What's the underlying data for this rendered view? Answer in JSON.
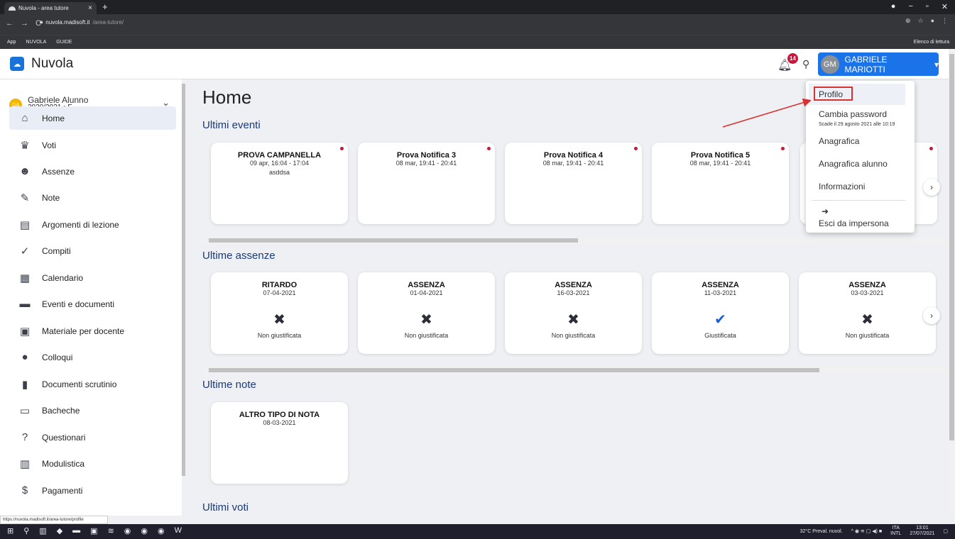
{
  "browser": {
    "tab_title": "Nuvola - area tutore",
    "tab_close": "×",
    "new_tab": "+",
    "url_host": "nuvola.madisoft.it",
    "url_path": "/area-tutore/",
    "nav_back": "←",
    "nav_forward": "→",
    "nav_reload": "C",
    "bookmarks": [
      "App",
      "NUVOLA",
      "GUIDE"
    ],
    "reading_list": "Elenco di lettura",
    "status_url": "https://nuvola.madisoft.it/area-tutore/profile"
  },
  "header": {
    "app_name": "Nuvola",
    "notifications_count": "14",
    "user_initials": "GM",
    "user_name": "GABRIELE MARIOTTI",
    "user_caret": "▾"
  },
  "sidebar": {
    "student_initials": "GA",
    "student_name": "Gabriele Alunno",
    "student_year": "2020/2021 • F",
    "items": [
      {
        "label": "Home",
        "icon": "home-icon",
        "glyph": "⌂"
      },
      {
        "label": "Voti",
        "icon": "trophy-icon",
        "glyph": "♛"
      },
      {
        "label": "Assenze",
        "icon": "user-check-icon",
        "glyph": "☻"
      },
      {
        "label": "Note",
        "icon": "note-icon",
        "glyph": "✎"
      },
      {
        "label": "Argomenti di lezione",
        "icon": "book-icon",
        "glyph": "▤"
      },
      {
        "label": "Compiti",
        "icon": "spellcheck-icon",
        "glyph": "✓"
      },
      {
        "label": "Calendario",
        "icon": "calendar-icon",
        "glyph": "▦"
      },
      {
        "label": "Eventi e documenti",
        "icon": "folder-icon",
        "glyph": "▬"
      },
      {
        "label": "Materiale per docente",
        "icon": "chalkboard-icon",
        "glyph": "▣"
      },
      {
        "label": "Colloqui",
        "icon": "chat-icon",
        "glyph": "●"
      },
      {
        "label": "Documenti scrutinio",
        "icon": "document-icon",
        "glyph": "▮"
      },
      {
        "label": "Bacheche",
        "icon": "board-icon",
        "glyph": "▭"
      },
      {
        "label": "Questionari",
        "icon": "question-icon",
        "glyph": "?"
      },
      {
        "label": "Modulistica",
        "icon": "forms-icon",
        "glyph": "▥"
      },
      {
        "label": "Pagamenti",
        "icon": "payment-icon",
        "glyph": "$"
      }
    ]
  },
  "main": {
    "title": "Home",
    "events_title": "Ultimi eventi",
    "events": [
      {
        "title": "PROVA CAMPANELLA",
        "time": "09 apr, 16:04 - 17:04",
        "desc": "asddsa"
      },
      {
        "title": "Prova Notifica 3",
        "time": "08 mar, 19:41 - 20:41",
        "desc": ""
      },
      {
        "title": "Prova Notifica 4",
        "time": "08 mar, 19:41 - 20:41",
        "desc": ""
      },
      {
        "title": "Prova Notifica 5",
        "time": "08 mar, 19:41 - 20:41",
        "desc": ""
      }
    ],
    "absences_title": "Ultime assenze",
    "absences": [
      {
        "type": "RITARDO",
        "date": "07-04-2021",
        "status": "Non giustificata",
        "justified": false
      },
      {
        "type": "ASSENZA",
        "date": "01-04-2021",
        "status": "Non giustificata",
        "justified": false
      },
      {
        "type": "ASSENZA",
        "date": "16-03-2021",
        "status": "Non giustificata",
        "justified": false
      },
      {
        "type": "ASSENZA",
        "date": "11-03-2021",
        "status": "Giustificata",
        "justified": true
      },
      {
        "type": "ASSENZA",
        "date": "03-03-2021",
        "status": "Non giustificata",
        "justified": false
      }
    ],
    "notes_title": "Ultime note",
    "notes": [
      {
        "type": "ALTRO TIPO DI NOTA",
        "date": "08-03-2021"
      }
    ],
    "grades_title": "Ultimi voti",
    "scroll_next": "›"
  },
  "user_menu": {
    "profile": "Profilo",
    "change_password": "Cambia password",
    "password_expiry": "Scade il 29 agosto 2021 alle 10:19",
    "registry": "Anagrafica",
    "student_registry": "Anagrafica alunno",
    "info": "Informazioni",
    "exit_impersonation": "Esci da impersona"
  },
  "taskbar": {
    "weather": "32°C Preval. nuvol.",
    "lang_top": "ITA",
    "lang_bottom": "INTL",
    "time": "13:01",
    "date": "27/07/2021"
  },
  "colors": {
    "primary": "#1a73e8",
    "title_blue": "#1a3a78",
    "accent_red": "#c8173b",
    "highlight_red": "#d93030"
  }
}
